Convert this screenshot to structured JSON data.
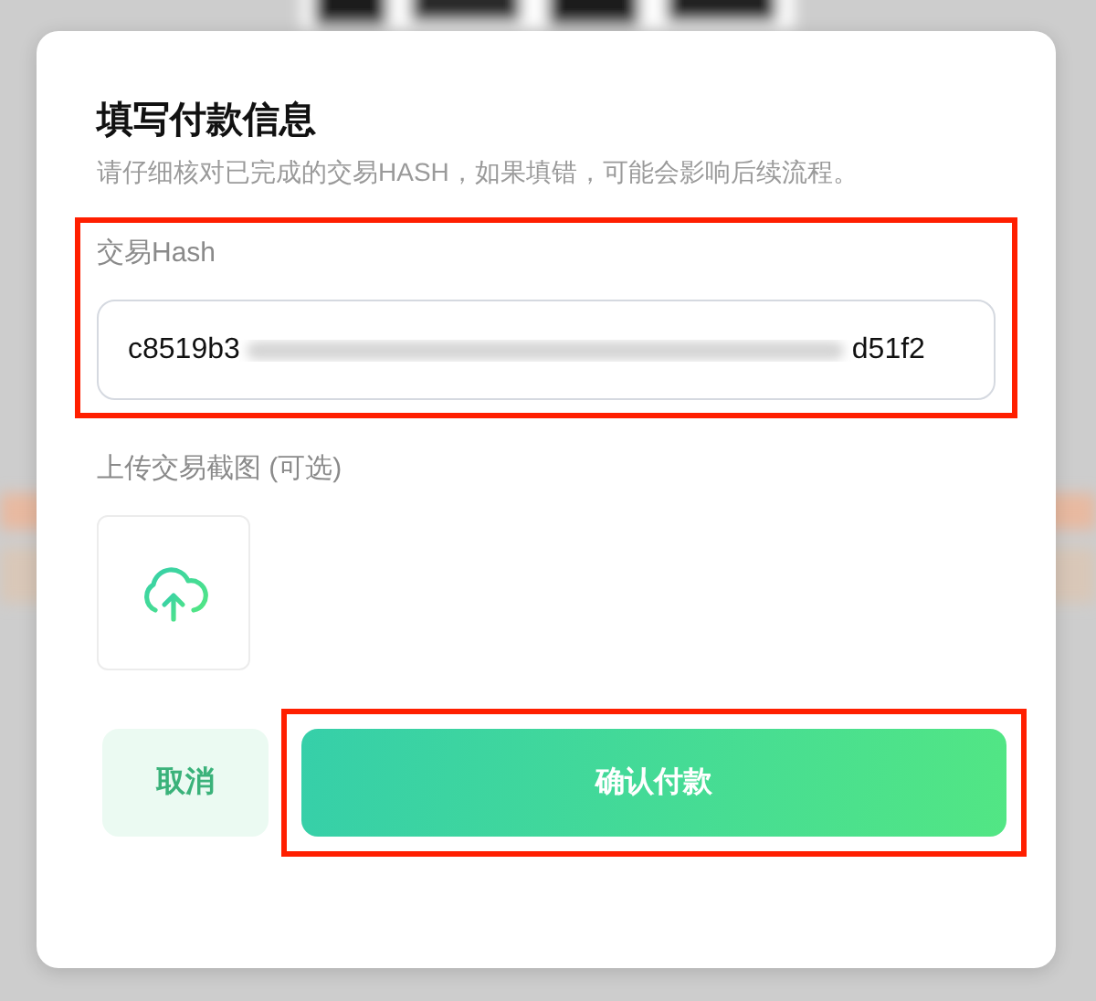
{
  "dialog": {
    "title": "填写付款信息",
    "description": "请仔细核对已完成的交易HASH，如果填错，可能会影响后续流程。"
  },
  "hash_field": {
    "label": "交易Hash",
    "value_start": "c8519b3",
    "value_end": "d51f2",
    "highlighted": true
  },
  "upload": {
    "label": "上传交易截图 (可选)"
  },
  "buttons": [
    {
      "kind": "secondary",
      "label": "取消",
      "highlighted": false
    },
    {
      "kind": "primary",
      "label": "确认付款",
      "highlighted": true
    }
  ]
}
